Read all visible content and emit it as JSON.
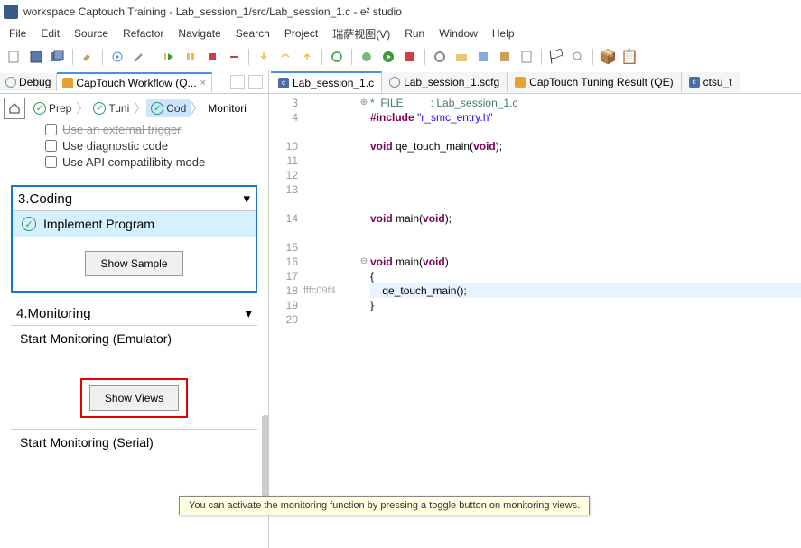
{
  "title": "workspace Captouch Training - Lab_session_1/src/Lab_session_1.c - e² studio",
  "menu": [
    "File",
    "Edit",
    "Source",
    "Refactor",
    "Navigate",
    "Search",
    "Project",
    "瑞萨视图(V)",
    "Run",
    "Window",
    "Help"
  ],
  "left_tabs": {
    "debug": "Debug",
    "workflow": "CapTouch Workflow (Q...",
    "close": "×"
  },
  "breadcrumbs": {
    "prep": "Prep",
    "tuni": "Tuni",
    "cod": "Cod",
    "monitoring": "Monitori"
  },
  "checks": {
    "trigger": "Use an external trigger",
    "diag": "Use diagnostic code",
    "api": "Use API compatilibity mode"
  },
  "coding": {
    "title": "3.Coding",
    "item": "Implement Program",
    "sample_btn": "Show Sample"
  },
  "monitoring": {
    "title": "4.Monitoring",
    "emulator": "Start Monitoring (Emulator)",
    "views_btn": "Show Views",
    "serial": "Start Monitoring (Serial)"
  },
  "tooltip": "You can activate the monitoring function by pressing a toggle button on monitoring views.",
  "editor_tabs": {
    "t1": "Lab_session_1.c",
    "t2": "Lab_session_1.scfg",
    "t3": "CapTouch Tuning Result (QE)",
    "t4": "ctsu_t"
  },
  "code": {
    "l3a": "*  FILE         : Lab_session_1.c",
    "l4": "#include",
    "l4s": " \"r_smc_entry.h\"",
    "l6a": "void",
    "l6b": " qe_touch_main(",
    "l6c": "void",
    "l6d": ");",
    "l8a": "void",
    "l8b": " main(",
    "l8c": "void",
    "l8d": ");",
    "l10a": "void",
    "l10b": " main(",
    "l10c": "void",
    "l10d": ")",
    "l11": "{",
    "l12": "    qe_touch_main();",
    "l13": "}",
    "ann18": "fffc09f4"
  },
  "line_numbers": [
    "3",
    "4",
    "",
    "10",
    "11",
    "12",
    "13",
    "",
    "14",
    "",
    "15",
    "16",
    "17",
    "18",
    "19",
    "20"
  ]
}
